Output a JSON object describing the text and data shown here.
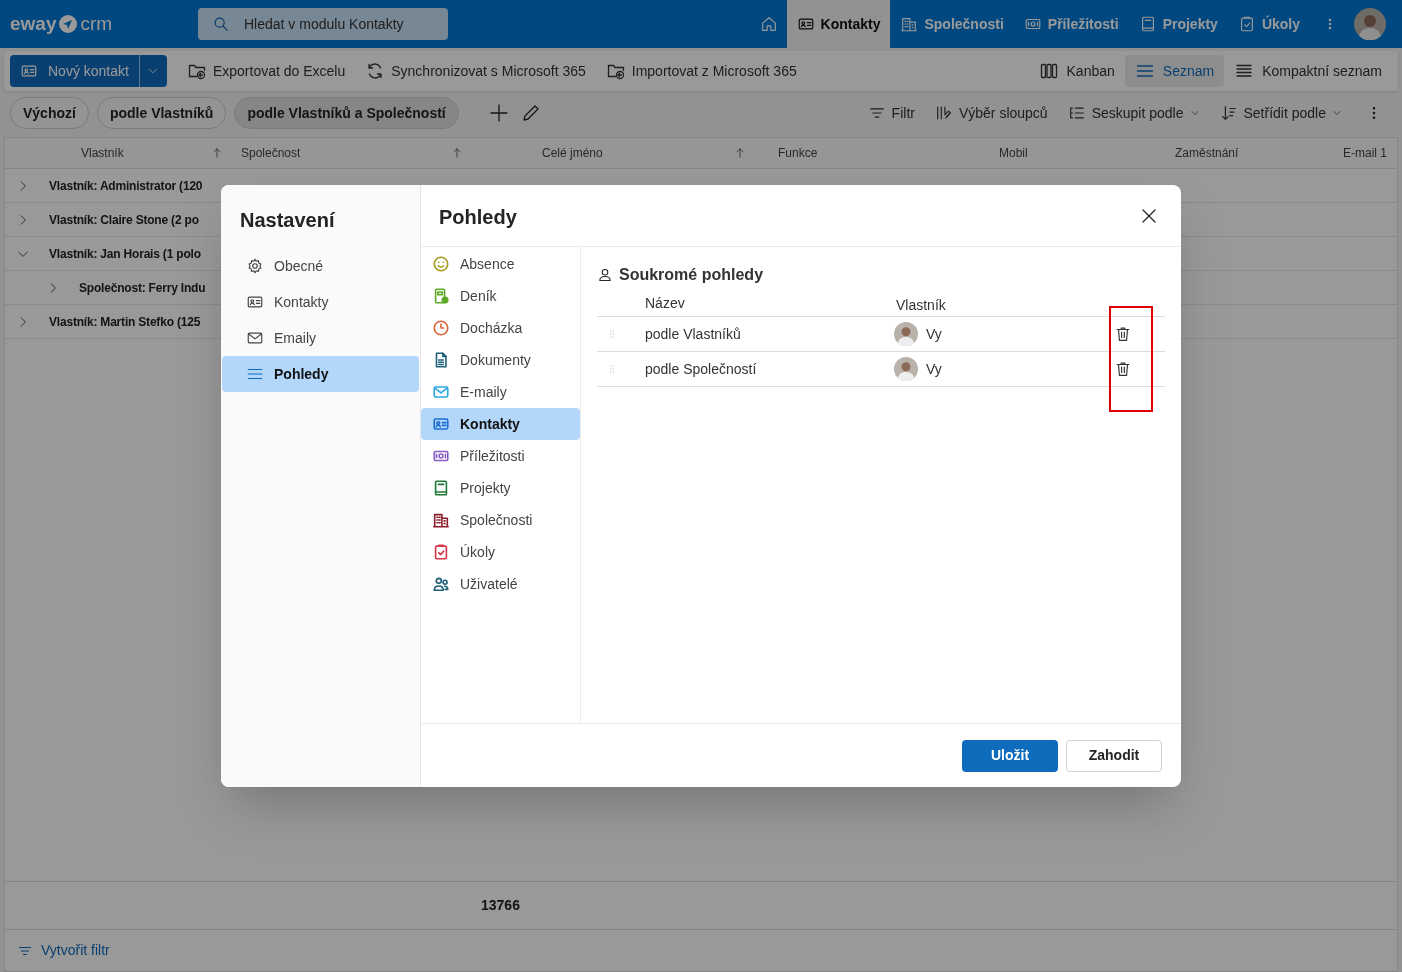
{
  "header": {
    "logo_left": "eway",
    "logo_right": "crm",
    "search": {
      "placeholder": "Hledat v modulu Kontakty"
    },
    "tabs": [
      {
        "label": "Kontakty",
        "selected": true
      },
      {
        "label": "Společnosti",
        "selected": false
      },
      {
        "label": "Příležitosti",
        "selected": false
      },
      {
        "label": "Projekty",
        "selected": false
      },
      {
        "label": "Úkoly",
        "selected": false
      }
    ]
  },
  "toolbar": {
    "new_button": "Nový kontakt",
    "actions": [
      {
        "label": "Exportovat do Excelu"
      },
      {
        "label": "Synchronizovat s Microsoft 365"
      },
      {
        "label": "Importovat z Microsoft 365"
      }
    ],
    "view_modes": [
      {
        "label": "Kanban",
        "selected": false
      },
      {
        "label": "Seznam",
        "selected": true
      },
      {
        "label": "Kompaktní seznam",
        "selected": false
      }
    ]
  },
  "views": {
    "chips": [
      {
        "label": "Výchozí",
        "selected": false
      },
      {
        "label": "podle Vlastníků",
        "selected": false
      },
      {
        "label": "podle Vlastníků a Společností",
        "selected": true
      }
    ],
    "tools": [
      {
        "label": "Filtr",
        "dropdown": false
      },
      {
        "label": "Výběr sloupců",
        "dropdown": false
      },
      {
        "label": "Seskupit podle",
        "dropdown": true
      },
      {
        "label": "Setřídit podle",
        "dropdown": true
      }
    ]
  },
  "table": {
    "columns": [
      {
        "label": "Vlastník",
        "sorted": true
      },
      {
        "label": "Společnost",
        "sorted": true
      },
      {
        "label": "Celé jméno",
        "sorted": true
      },
      {
        "label": "Funkce",
        "sorted": false
      },
      {
        "label": "Mobil",
        "sorted": false
      },
      {
        "label": "Zaměstnání",
        "sorted": false
      },
      {
        "label": "E-mail 1",
        "sorted": false
      }
    ],
    "groups": [
      {
        "label": "Vlastník: Administrator (120",
        "expanded": false
      },
      {
        "label": "Vlastník: Claire Stone (2 po",
        "expanded": false
      },
      {
        "label": "Vlastník: Jan Horais (1 polo",
        "expanded": true,
        "children": [
          {
            "label": "Společnost: Ferry Indu",
            "expanded": false
          }
        ]
      },
      {
        "label": "Vlastník: Martin Stefko (125",
        "expanded": false
      }
    ],
    "total": "13766"
  },
  "footer": {
    "create_filter": "Vytvořit filtr"
  },
  "dialog": {
    "title": "Nastavení",
    "nav": [
      {
        "label": "Obecné",
        "selected": false
      },
      {
        "label": "Kontakty",
        "selected": false
      },
      {
        "label": "Emaily",
        "selected": false
      },
      {
        "label": "Pohledy",
        "selected": true
      }
    ],
    "panel_title": "Pohledy",
    "modules": [
      {
        "label": "Absence",
        "color": "#a89a1c",
        "selected": false
      },
      {
        "label": "Deník",
        "color": "#5ea828",
        "selected": false
      },
      {
        "label": "Docházka",
        "color": "#d9663a",
        "selected": false
      },
      {
        "label": "Dokumenty",
        "color": "#1f5f7a",
        "selected": false
      },
      {
        "label": "E-maily",
        "color": "#2aa6e0",
        "selected": false
      },
      {
        "label": "Kontakty",
        "color": "#1a6fd0",
        "selected": true
      },
      {
        "label": "Příležitosti",
        "color": "#8a5cc6",
        "selected": false
      },
      {
        "label": "Projekty",
        "color": "#1f7a3a",
        "selected": false
      },
      {
        "label": "Společnosti",
        "color": "#8c1d2a",
        "selected": false
      },
      {
        "label": "Úkoly",
        "color": "#d9364a",
        "selected": false
      },
      {
        "label": "Uživatelé",
        "color": "#1f5f7a",
        "selected": false
      }
    ],
    "section": {
      "title": "Soukromé pohledy",
      "columns": [
        "Název",
        "Vlastník"
      ],
      "rows": [
        {
          "name": "podle Vlastníků",
          "owner": "Vy"
        },
        {
          "name": "podle Společností",
          "owner": "Vy"
        }
      ]
    },
    "save": "Uložit",
    "discard": "Zahodit"
  }
}
